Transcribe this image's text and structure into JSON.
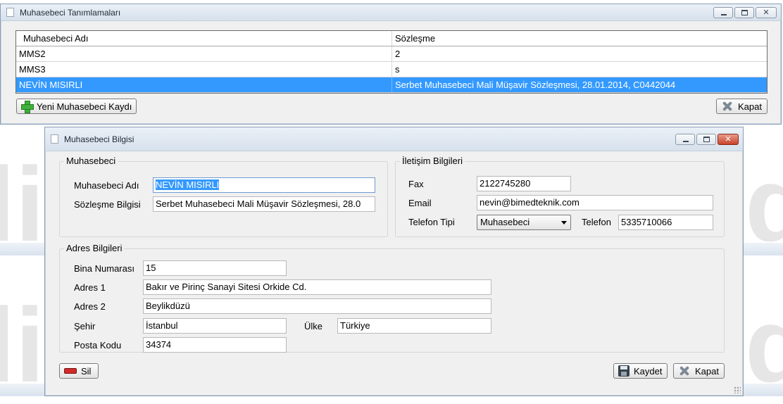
{
  "list_window": {
    "title": "Muhasebeci Tanımlamaları",
    "columns": [
      "Muhasebeci Adı",
      "Sözleşme"
    ],
    "rows": [
      {
        "name": "MMS2",
        "contract": "2"
      },
      {
        "name": "MMS3",
        "contract": "s"
      },
      {
        "name": "NEVİN MISIRLI",
        "contract": "Serbet Muhasebeci Mali Müşavir Sözleşmesi, 28.01.2014, C0442044"
      }
    ],
    "new_button": "Yeni Muhasebeci Kaydı",
    "close_button": "Kapat"
  },
  "detail_window": {
    "title": "Muhasebeci Bilgisi",
    "muhasebeci": {
      "group_title": "Muhasebeci",
      "name_label": "Muhasebeci Adı",
      "name_value": "NEVİN MISIRLI",
      "contract_label": "Sözleşme Bilgisi",
      "contract_value": "Serbet Muhasebeci Mali Müşavir Sözleşmesi, 28.0"
    },
    "iletisim": {
      "group_title": "İletişim Bilgileri",
      "fax_label": "Fax",
      "fax_value": "2122745280",
      "email_label": "Email",
      "email_value": "nevin@bimedteknik.com",
      "phone_type_label": "Telefon Tipi",
      "phone_type_value": "Muhasebeci",
      "phone_label": "Telefon",
      "phone_value": "5335710066"
    },
    "adres": {
      "group_title": "Adres Bilgileri",
      "bina_label": "Bina Numarası",
      "bina_value": "15",
      "adres1_label": "Adres 1",
      "adres1_value": "Bakır ve Pirinç Sanayi Sitesi Orkide Cd.",
      "adres2_label": "Adres 2",
      "adres2_value": "Beylikdüzü",
      "sehir_label": "Şehir",
      "sehir_value": "İstanbul",
      "ulke_label": "Ülke",
      "ulke_value": "Türkiye",
      "posta_label": "Posta Kodu",
      "posta_value": "34374"
    },
    "delete_button": "Sil",
    "save_button": "Kaydet",
    "close_button": "Kapat"
  },
  "colors": {
    "selection": "#3399ff",
    "window_bg": "#f0f0f0",
    "close_red": "#c7432a"
  },
  "icons": {
    "title_doc": "document-icon",
    "new": "plus-icon",
    "close": "x-icon",
    "delete": "minus-icon",
    "save": "disk-icon"
  }
}
